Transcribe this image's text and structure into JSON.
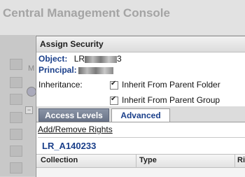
{
  "app": {
    "title": "Central Management Console"
  },
  "dialog": {
    "title": "Assign Security",
    "object_label": "Object:",
    "object_value_prefix": "LR",
    "object_value_suffix": "3",
    "principal_label": "Principal:",
    "inheritance_label": "Inheritance:",
    "inherit_folder": "Inherit From Parent Folder",
    "inherit_group": "Inherit From Parent Group",
    "tabs": [
      "Access Levels",
      "Advanced"
    ],
    "add_remove": "Add/Remove Rights",
    "object_name": "LR_A140233",
    "columns": [
      "Collection",
      "Type",
      "Ri"
    ]
  },
  "sidebar": {
    "partial_label": "M"
  }
}
